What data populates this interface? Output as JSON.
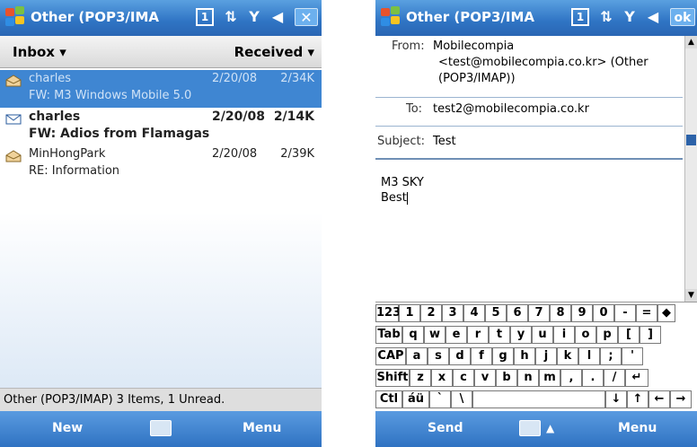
{
  "left_screen": {
    "title": "Other (POP3/IMA",
    "list_header": {
      "folder": "Inbox ▾",
      "sort": "Received ▾"
    },
    "messages": [
      {
        "from": "charles",
        "date": "2/20/08",
        "size": "2/34K",
        "subject": "FW: M3 Windows Mobile 5.0",
        "state": "selected"
      },
      {
        "from": "charles",
        "date": "2/20/08",
        "size": "2/14K",
        "subject": "FW: Adios from Flamagas",
        "state": "unread"
      },
      {
        "from": "MinHongPark",
        "date": "2/20/08",
        "size": "2/39K",
        "subject": "RE: Information",
        "state": "read"
      }
    ],
    "status": "Other (POP3/IMAP)  3 Items, 1 Unread.",
    "softkeys": {
      "left": "New",
      "right": "Menu"
    }
  },
  "right_screen": {
    "title": "Other (POP3/IMA",
    "ok_label": "ok",
    "from_label": "From:",
    "from_lines": [
      "Mobilecompia",
      "<test@mobilecompia.co.kr> (Other",
      "(POP3/IMAP))"
    ],
    "to_label": "To:",
    "to_value": "test2@mobilecompia.co.kr",
    "subject_label": "Subject:",
    "subject_value": "Test",
    "body_lines": [
      "M3 SKY",
      "Best"
    ],
    "keyboard": {
      "row1": [
        "123",
        "1",
        "2",
        "3",
        "4",
        "5",
        "6",
        "7",
        "8",
        "9",
        "0",
        "-",
        "=",
        "◆"
      ],
      "row2": [
        "Tab",
        "q",
        "w",
        "e",
        "r",
        "t",
        "y",
        "u",
        "i",
        "o",
        "p",
        "[",
        "]"
      ],
      "row3": [
        "CAP",
        "a",
        "s",
        "d",
        "f",
        "g",
        "h",
        "j",
        "k",
        "l",
        ";",
        "'"
      ],
      "row4": [
        "Shift",
        "z",
        "x",
        "c",
        "v",
        "b",
        "n",
        "m",
        ",",
        ".",
        "/",
        "↵"
      ],
      "row5": [
        "Ctl",
        "áü",
        "`",
        "\\",
        "↓",
        "↑",
        "←",
        "→"
      ]
    },
    "softkeys": {
      "left": "Send",
      "right": "Menu"
    }
  },
  "icons": {
    "windows_flag": "windows-start-icon",
    "connectivity": "connectivity-icon",
    "signal": "signal-icon",
    "volume": "volume-icon",
    "input_panel": "keyboard-icon"
  },
  "colors": {
    "title_blue": "#2f74c4",
    "selection_blue": "#3f86d2"
  }
}
